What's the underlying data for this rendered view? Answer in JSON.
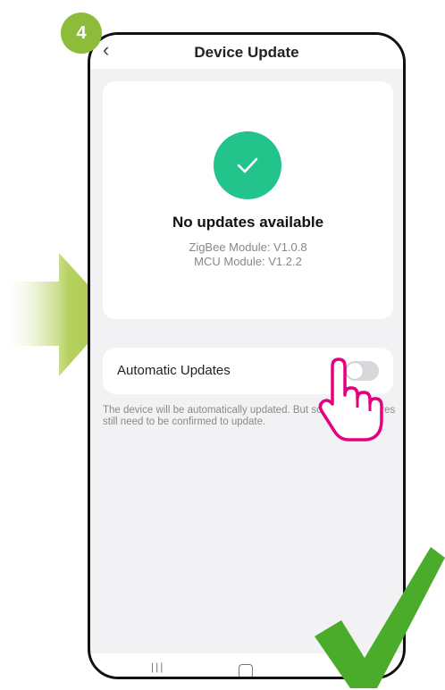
{
  "step": {
    "number": "4"
  },
  "header": {
    "back_icon": "chevron-left-icon",
    "title": "Device Update"
  },
  "status": {
    "icon": "check-icon",
    "title": "No updates available",
    "zigbee": "ZigBee Module: V1.0.8",
    "mcu": "MCU Module: V1.2.2",
    "accent_color": "#22c48b"
  },
  "auto_update": {
    "label": "Automatic Updates",
    "enabled": false,
    "note": "The device will be automatically updated. But some key features still need to be confirmed to update."
  },
  "navbar": {
    "recents_icon": "recents-icon",
    "home_icon": "home-icon"
  },
  "decor": {
    "arrow_color": "#a8c84a",
    "hand_color": "#e6007e",
    "big_check_color": "#4aac2a"
  }
}
